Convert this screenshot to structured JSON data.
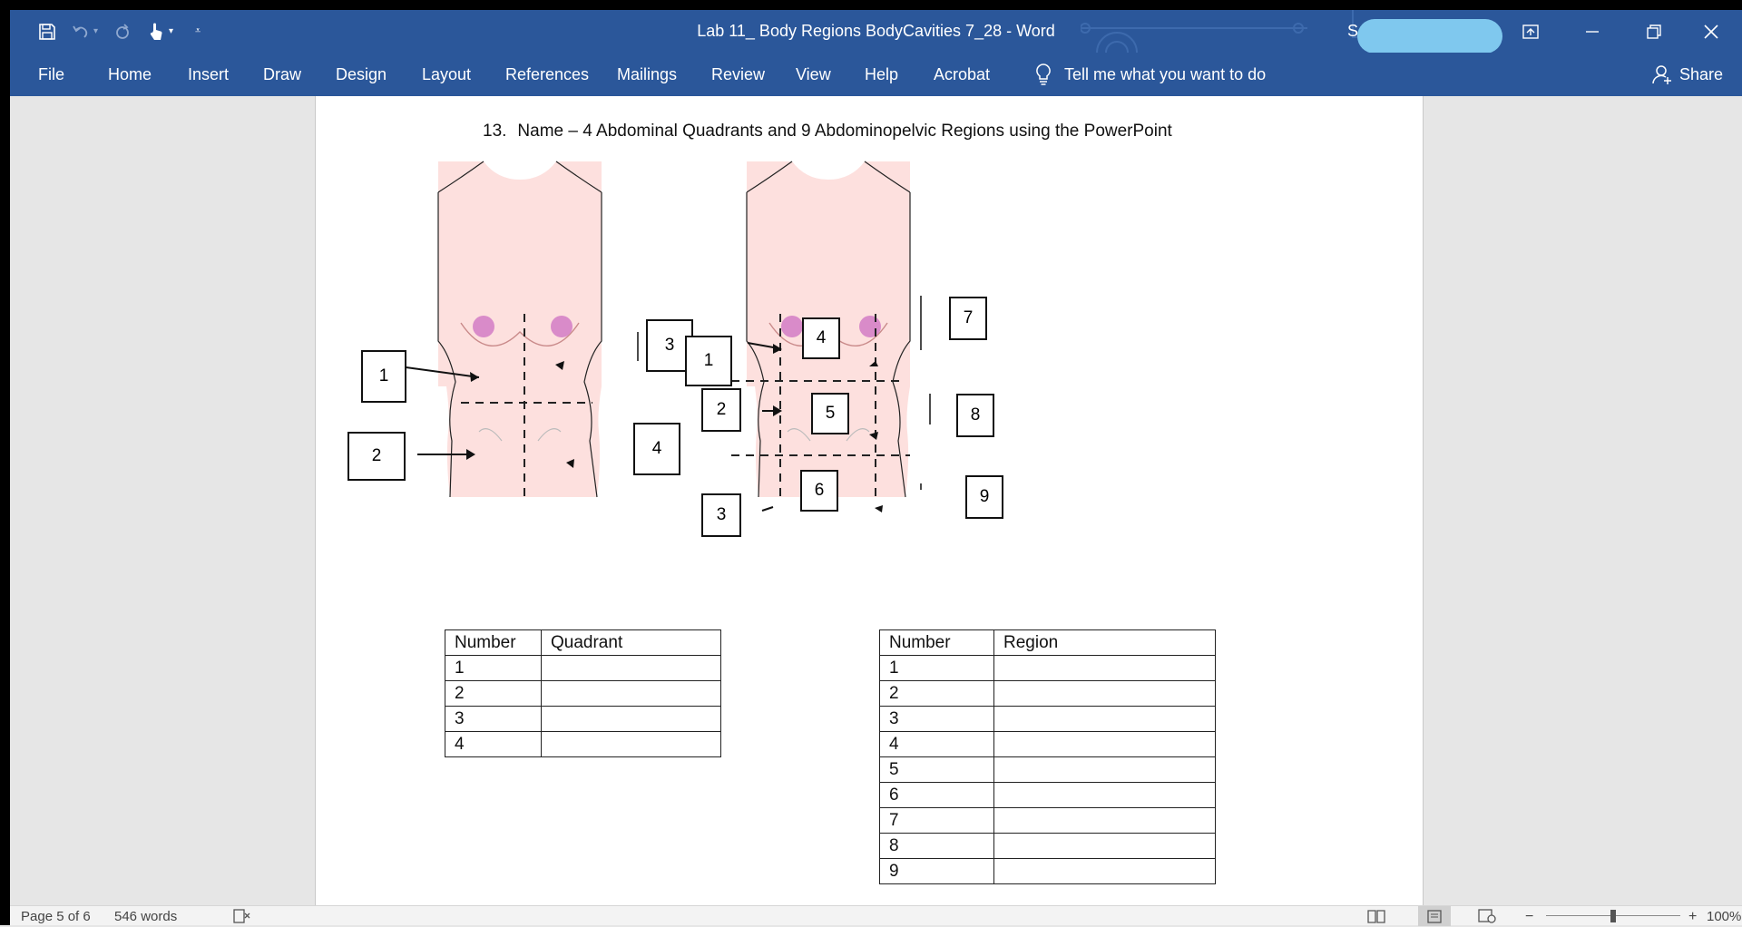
{
  "window": {
    "title": "Lab 11_ Body Regions BodyCavities 7_28  -  Word",
    "account_initial": "S"
  },
  "ribbon": {
    "tabs": [
      "File",
      "Home",
      "Insert",
      "Draw",
      "Design",
      "Layout",
      "References",
      "Mailings",
      "Review",
      "View",
      "Help",
      "Acrobat"
    ],
    "tell_me": "Tell me what you want to do",
    "share": "Share"
  },
  "document": {
    "question_number": "13.",
    "question_text": "Name – 4 Abdominal Quadrants and 9 Abdominopelvic Regions using the PowerPoint",
    "quadrant_figure": {
      "labels": [
        "1",
        "2",
        "3",
        "4"
      ]
    },
    "region_figure": {
      "labels": [
        "1",
        "2",
        "3",
        "4",
        "5",
        "6",
        "7",
        "8",
        "9"
      ]
    },
    "quadrant_table": {
      "headers": [
        "Number",
        "Quadrant"
      ],
      "rows": [
        "1",
        "2",
        "3",
        "4"
      ]
    },
    "region_table": {
      "headers": [
        "Number",
        "Region"
      ],
      "rows": [
        "1",
        "2",
        "3",
        "4",
        "5",
        "6",
        "7",
        "8",
        "9"
      ]
    }
  },
  "status": {
    "page": "Page 5 of 6",
    "words": "546 words",
    "zoom": "100%"
  },
  "colors": {
    "ribbon": "#2b579a",
    "skin": "#fde0de",
    "nipple": "#d98bc9"
  }
}
